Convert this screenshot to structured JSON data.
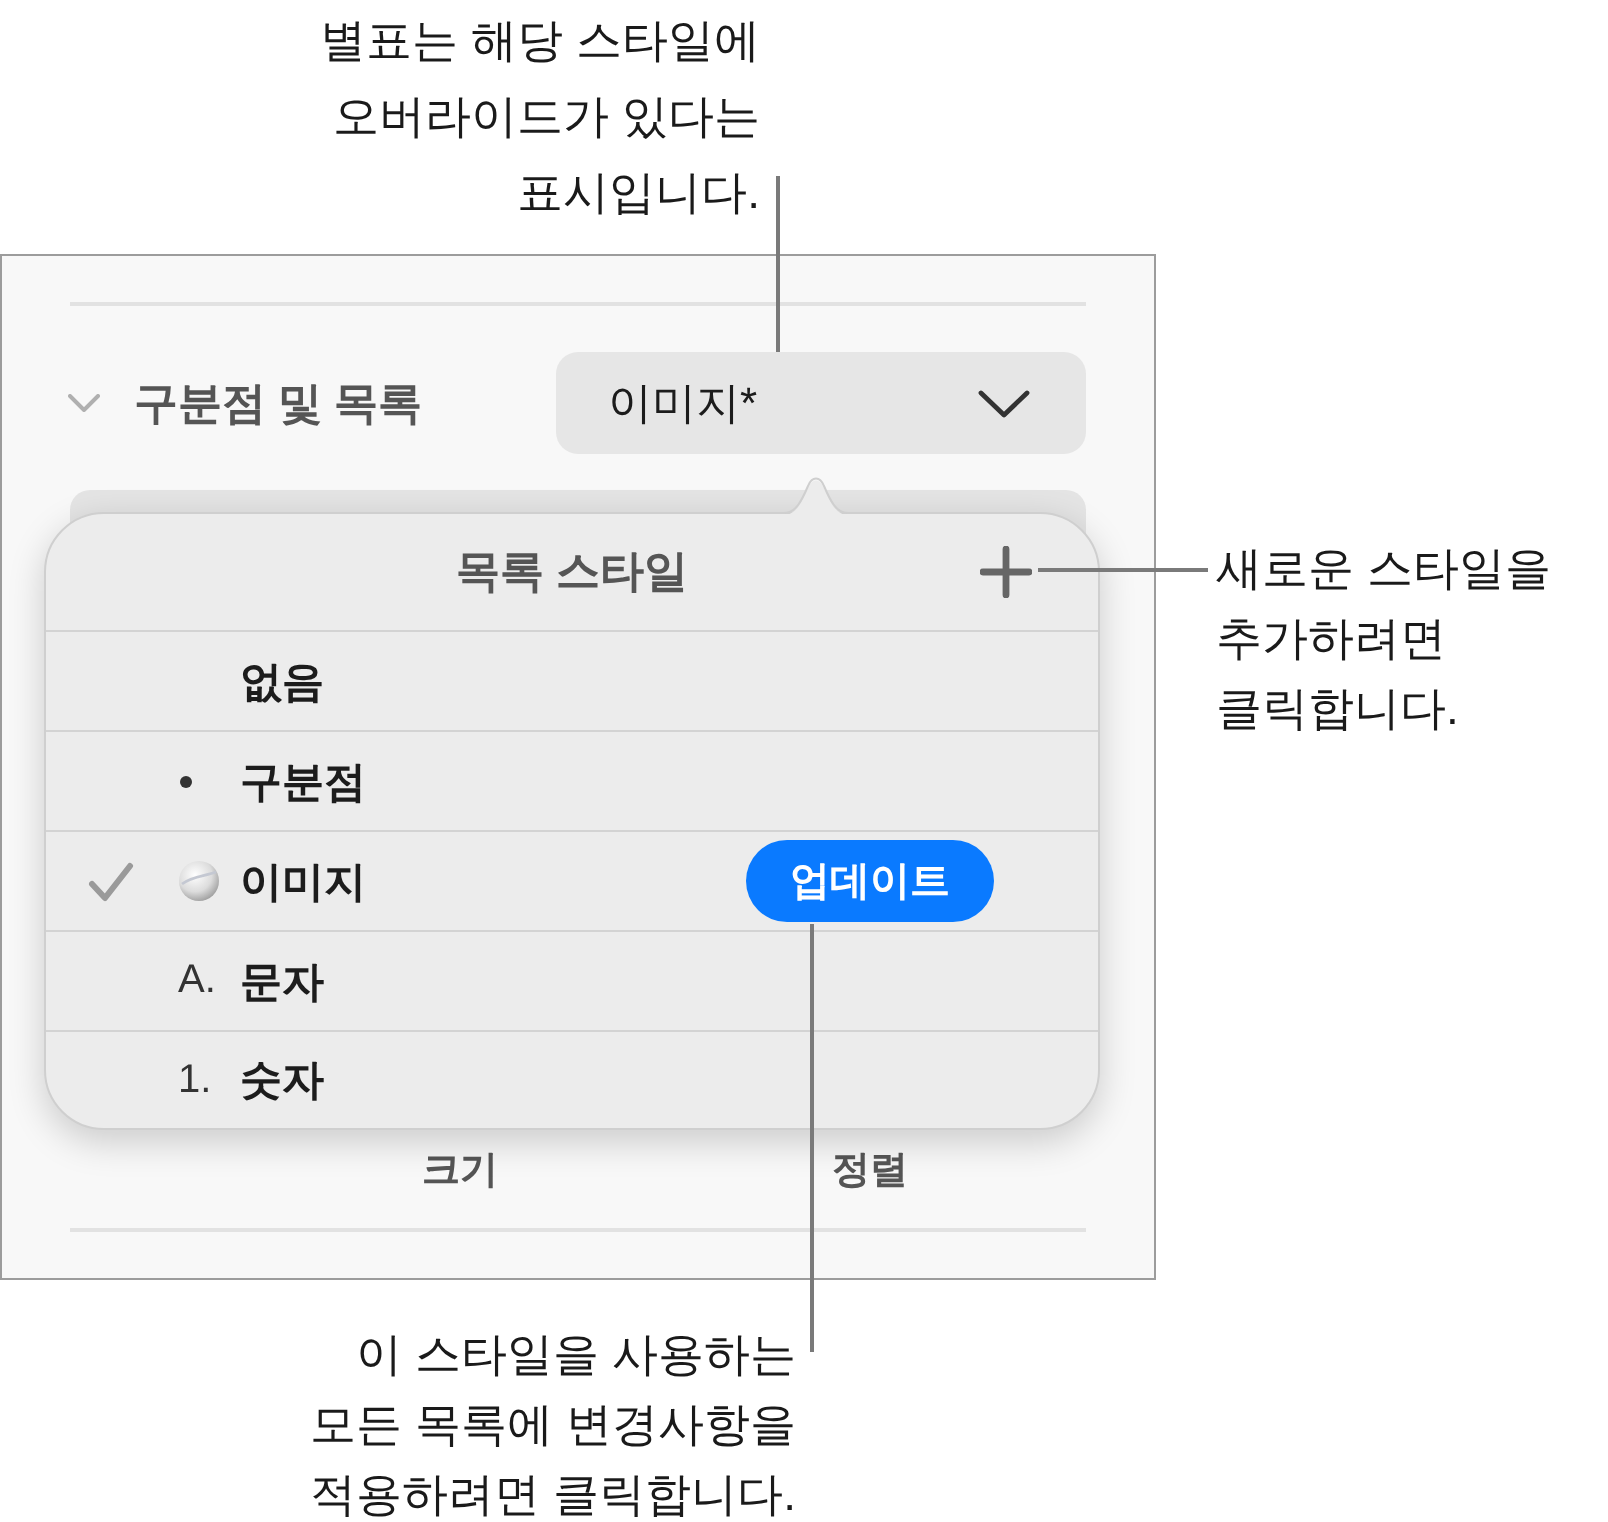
{
  "callouts": [
    {
      "kind": "top",
      "lines": [
        "별표는 해당 스타일에",
        "오버라이드가 있다는",
        "표시입니다."
      ]
    },
    {
      "kind": "right",
      "lines": [
        "새로운 스타일을",
        "추가하려면",
        "클릭합니다."
      ]
    },
    {
      "kind": "bottom",
      "lines": [
        "이 스타일을 사용하는",
        "모든 목록에 변경사항을",
        "적용하려면 클릭합니다."
      ]
    }
  ],
  "panel": {
    "section": {
      "title": "구분점 및 목록",
      "expanded": true
    },
    "style_menu": {
      "value": "이미지*"
    },
    "footer_labels": [
      "크기",
      "정렬"
    ]
  },
  "popover": {
    "title": "목록 스타일",
    "items": [
      {
        "kind": "none",
        "label": "없음",
        "selected": false
      },
      {
        "kind": "bullet",
        "label": "구분점",
        "selected": false
      },
      {
        "kind": "image",
        "label": "이미지",
        "selected": true,
        "action": "업데이트"
      },
      {
        "kind": "text",
        "marker": "A.",
        "label": "문자",
        "selected": false
      },
      {
        "kind": "text",
        "marker": "1.",
        "label": "숫자",
        "selected": false
      }
    ]
  }
}
